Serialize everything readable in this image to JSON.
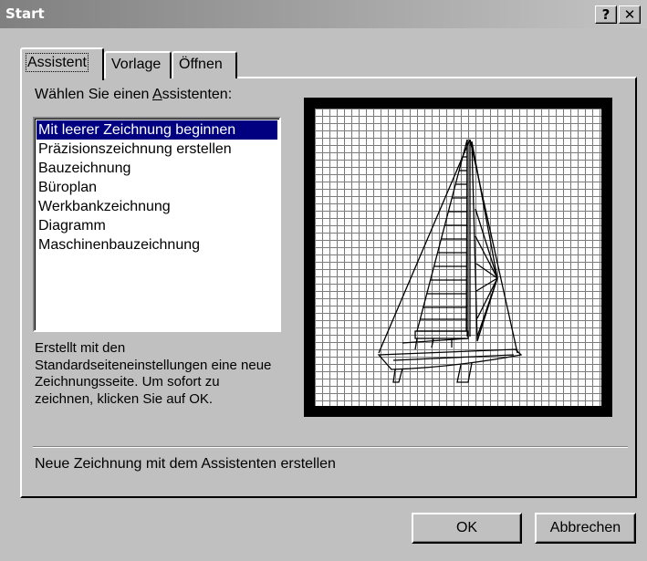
{
  "window": {
    "title": "Start",
    "help_button": "?",
    "close_button": "✕"
  },
  "tabs": [
    {
      "label": "Assistent"
    },
    {
      "label": "Vorlage"
    },
    {
      "label": "Öffnen"
    }
  ],
  "wizard": {
    "prompt_before": "Wählen Sie einen ",
    "prompt_mnemonic": "A",
    "prompt_after": "ssistenten:",
    "items": [
      "Mit leerer Zeichnung beginnen",
      "Präzisionszeichnung erstellen",
      "Bauzeichnung",
      "Büroplan",
      "Werkbankzeichnung",
      "Diagramm",
      "Maschinenbauzeichnung"
    ],
    "selected_item": "Mit leerer Zeichnung beginnen",
    "description": "Erstellt mit den Standardseiteneinstellungen eine neue Zeichnungsseite. Um sofort zu zeichnen, klicken Sie auf OK."
  },
  "preview": {
    "icon": "sailboat-drawing"
  },
  "status_text": "Neue Zeichnung mit dem Assistenten erstellen",
  "buttons": {
    "ok": "OK",
    "cancel": "Abbrechen"
  },
  "colors": {
    "selection": "#000080",
    "dialog_bg": "#c0c0c0",
    "titlebar_start": "#808080",
    "titlebar_end": "#c4c4c4"
  }
}
